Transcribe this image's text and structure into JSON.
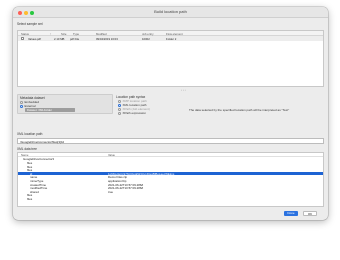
{
  "window": {
    "title": "Build location path"
  },
  "select_sample": {
    "label": "Select sample xml",
    "columns": [
      "Status",
      "↑",
      "Size",
      "Type",
      "Modified",
      "Job entry",
      "Flow element"
    ],
    "rows": [
      {
        "status": "",
        "name": "Values.pdf",
        "size": "2.10 MB",
        "type": "pdf File",
        "modified": "09/04/2019 16:03",
        "job_entry": "10002",
        "flow_element": "Folder 2"
      }
    ]
  },
  "metadata_dataset": {
    "label": "Metadata dataset",
    "options": [
      "Embedded",
      "External"
    ],
    "selected_value": "Dataset: XMLFolder"
  },
  "location_path_syntax": {
    "label": "Location path syntax",
    "options": [
      "XMP location path",
      "XML location path",
      "XPath (Job element)",
      "XPath expression"
    ]
  },
  "info_text": "The data selected by the specified location path will be interpreted as \"Text\"",
  "xml_location_path": {
    "label": "XML location path",
    "value": "/GoogleDriveConnector/files[3]/id"
  },
  "xml_data_tree": {
    "label": "XML data tree",
    "columns": [
      "Name",
      "Value"
    ],
    "rows": [
      {
        "key": "GoogleDriveConnector3",
        "value": "",
        "selected": false
      },
      {
        "key": "files",
        "value": "",
        "selected": false
      },
      {
        "key": "files",
        "value": "",
        "selected": false
      },
      {
        "key": "files",
        "value": "",
        "selected": false
      },
      {
        "key": "id",
        "value": "1pNNu3eCzk7NUtGoEW4UvvDisoBIBoLaecWEkns",
        "selected": true
      },
      {
        "key": "name",
        "value": "Demo Files.zip",
        "selected": false
      },
      {
        "key": "mimeType",
        "value": "application/zip",
        "selected": false
      },
      {
        "key": "createdTime",
        "value": "2021-06-22T10:57:09.286Z",
        "selected": false
      },
      {
        "key": "modifiedTime",
        "value": "2021-06-22T10:57:09.286Z",
        "selected": false
      },
      {
        "key": "shared",
        "value": "true",
        "selected": false
      },
      {
        "key": "files",
        "value": "",
        "selected": false
      },
      {
        "key": "files",
        "value": "",
        "selected": false
      }
    ]
  },
  "buttons": {
    "ok": "Done",
    "cancel": "OK"
  },
  "colors": {
    "selection": "#1d63d3",
    "primary_button": "#2b72e0"
  }
}
